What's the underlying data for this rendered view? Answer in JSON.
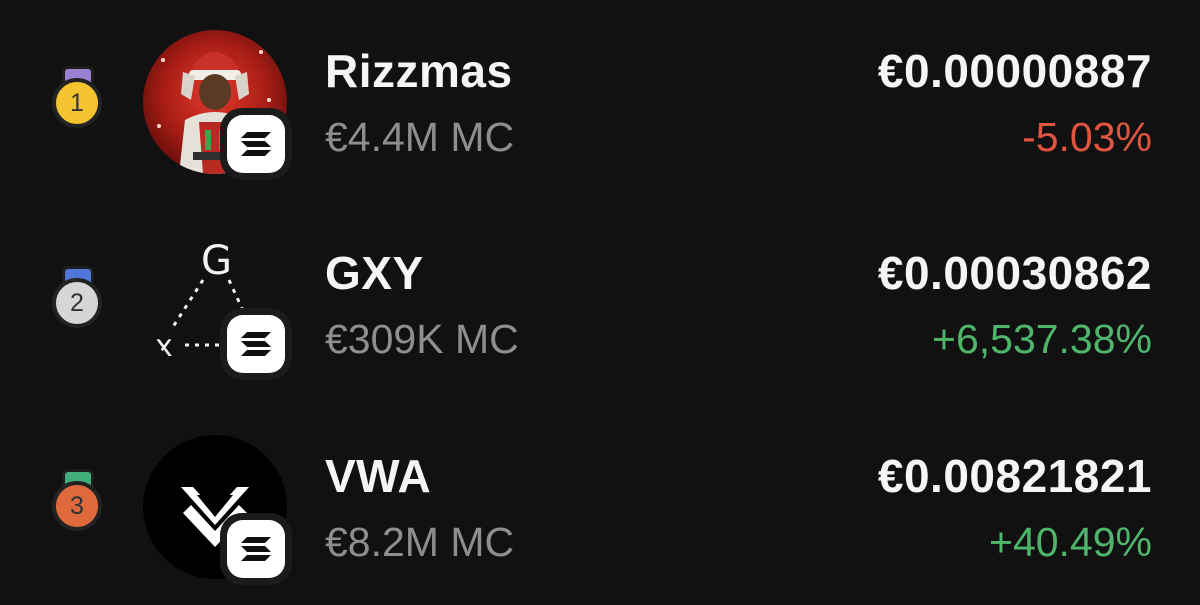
{
  "colors": {
    "background": "#111112",
    "negative": "#e0553f",
    "positive": "#4fb56b",
    "muted": "#8e8e8e"
  },
  "tokens": [
    {
      "rank": "1",
      "medal": "gold",
      "medal_color": "#f4c430",
      "ribbon_color": "#9b7fd1",
      "avatar_icon": "rizzmas-santa-avatar-icon",
      "chain_icon": "solana-icon",
      "name": "Rizzmas",
      "market_cap": "€4.4M MC",
      "price": "€0.00000887",
      "change": "-5.03%",
      "change_direction": "negative"
    },
    {
      "rank": "2",
      "medal": "silver",
      "medal_color": "#d6d6d6",
      "ribbon_color": "#4f76d8",
      "avatar_icon": "gxy-triangle-avatar-icon",
      "chain_icon": "solana-icon",
      "name": "GXY",
      "market_cap": "€309K MC",
      "price": "€0.00030862",
      "change": "+6,537.38%",
      "change_direction": "positive"
    },
    {
      "rank": "3",
      "medal": "bronze",
      "medal_color": "#e0693c",
      "ribbon_color": "#3fae7a",
      "avatar_icon": "vwa-chevron-avatar-icon",
      "chain_icon": "solana-icon",
      "name": "VWA",
      "market_cap": "€8.2M MC",
      "price": "€0.00821821",
      "change": "+40.49%",
      "change_direction": "positive"
    }
  ]
}
